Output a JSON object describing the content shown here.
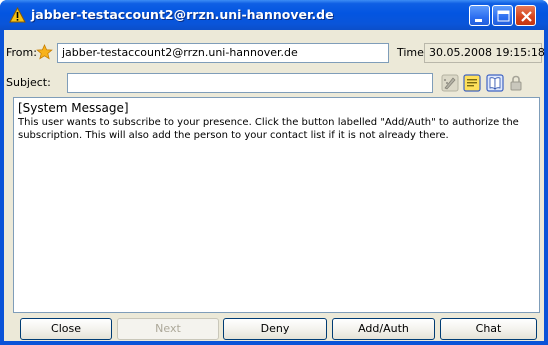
{
  "window": {
    "title": "jabber-testaccount2@rrzn.uni-hannover.de",
    "title_icon": "warning-icon",
    "controls": [
      "minimize-icon",
      "maximize-icon",
      "close-icon"
    ]
  },
  "header": {
    "from_label": "From:",
    "from_icon": "star-icon",
    "from_value": "jabber-testaccount2@rrzn.uni-hannover.de",
    "time_label": "Time:",
    "time_value": "30.05.2008 19:15:18",
    "subject_label": "Subject:",
    "subject_value": "",
    "tool_icons": [
      "edit-pen-icon",
      "note-icon",
      "book-icon",
      "lock-icon"
    ]
  },
  "message": {
    "heading": "[System Message]",
    "body": "This user wants to subscribe to your presence. Click the button labelled \"Add/Auth\" to authorize the subscription. This will also add the person to your contact list if it is not already there."
  },
  "buttons": {
    "close": "Close",
    "next": "Next",
    "deny": "Deny",
    "add_auth": "Add/Auth",
    "chat": "Chat"
  },
  "colors": {
    "titlebar": "#0355e1",
    "client_bg": "#ece9d8",
    "close_btn": "#d5421b"
  }
}
